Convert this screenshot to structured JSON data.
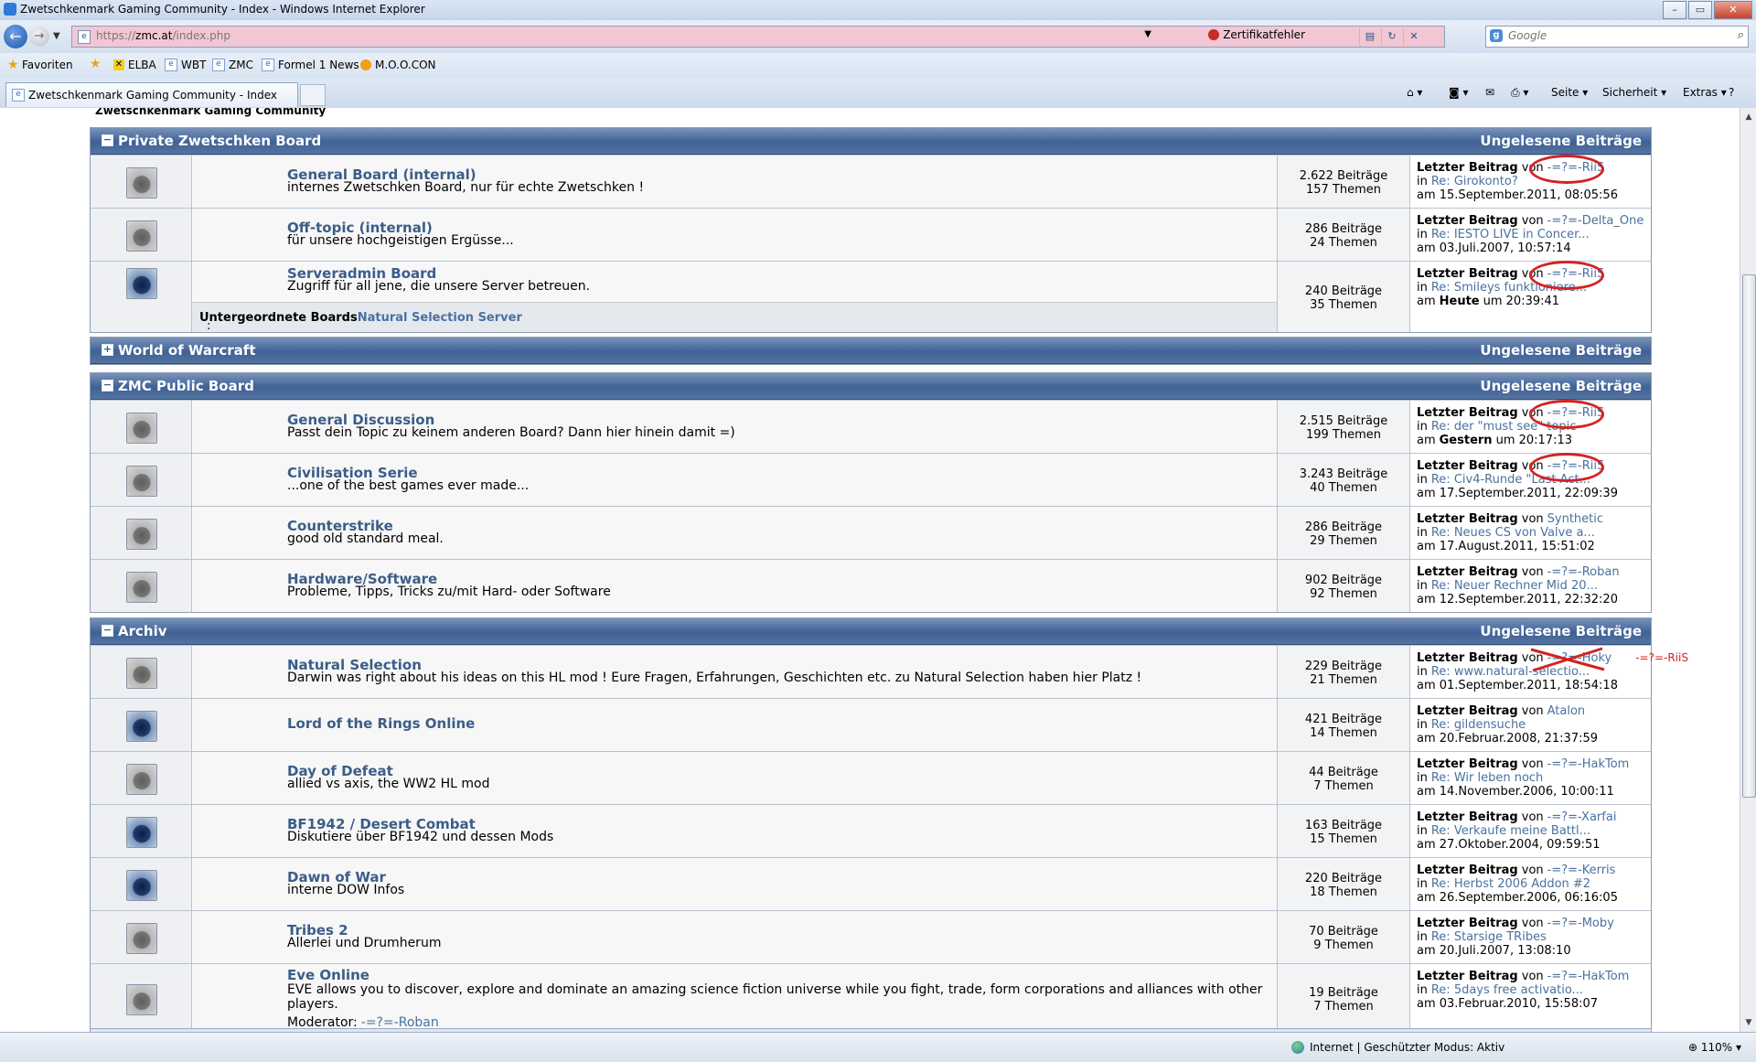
{
  "window": {
    "title": "Zwetschkenmark Gaming Community - Index - Windows Internet Explorer",
    "minimize": "–",
    "maximize": "▭",
    "close": "✕"
  },
  "nav": {
    "url_prefix": "https://",
    "url_host": "zmc.at",
    "url_path": "/index.php",
    "cert_error": "Zertifikatfehler",
    "search_placeholder": "Google"
  },
  "favorites": {
    "label": "Favoriten",
    "items": [
      "ELBA",
      "WBT",
      "ZMC",
      "Formel 1 News",
      "M.O.O.CON"
    ]
  },
  "tab": {
    "label": "Zwetschkenmark Gaming Community - Index"
  },
  "commands": {
    "page": "Seite",
    "security": "Sicherheit",
    "extras": "Extras"
  },
  "page": {
    "breadcrumb": "Zwetschkenmark Gaming Community"
  },
  "labels": {
    "unread": "Ungelesene Beiträge",
    "last_post": "Letzter Beitrag",
    "by": "von",
    "in": "in",
    "sub_boards": "Untergeordnete Boards",
    "moderator": "Moderator:"
  },
  "categories": [
    {
      "name": "Private Zwetschken Board",
      "toggle": "−",
      "boards": [
        {
          "title": "General Board (internal)",
          "desc": "internes Zwetschken Board, nur für echte Zwetschken !",
          "posts": "2.622 Beiträge",
          "topics": "157 Themen",
          "user": "-=?=-RiiS",
          "topic": "Re: Girokonto?",
          "date": "am 15.September.2011, 08:05:56",
          "icon_new": false
        },
        {
          "title": "Off-topic (internal)",
          "desc": "für unsere hochgeistigen Ergüsse...",
          "posts": "286 Beiträge",
          "topics": "24 Themen",
          "user": "-=?=-Delta_One",
          "topic": "Re: IESTO LIVE in Concer...",
          "date": "am 03.Juli.2007, 10:57:14",
          "icon_new": false
        },
        {
          "title": "Serveradmin Board",
          "desc": "Zugriff für all jene, die unsere Server betreuen.",
          "posts": "240 Beiträge",
          "topics": "35 Themen",
          "user": "-=?=-RiiS",
          "topic": "Re: Smileys funktioniere...",
          "date_pre": "am",
          "date_bold": "Heute",
          "date_post": "um 20:39:41",
          "sub_boards": "Natural Selection Server",
          "icon_new": true
        }
      ]
    },
    {
      "name": "World of Warcraft",
      "toggle": "+",
      "boards": []
    },
    {
      "name": "ZMC Public Board",
      "toggle": "−",
      "boards": [
        {
          "title": "General Discussion",
          "desc": "Passt dein Topic zu keinem anderen Board? Dann hier hinein damit =)",
          "posts": "2.515 Beiträge",
          "topics": "199 Themen",
          "user": "-=?=-RiiS",
          "topic": "Re: der \"must see\" topic",
          "date_pre": "am",
          "date_bold": "Gestern",
          "date_post": "um 20:17:13",
          "icon_new": false
        },
        {
          "title": "Civilisation Serie",
          "desc": "...one of the best games ever made...",
          "posts": "3.243 Beiträge",
          "topics": "40 Themen",
          "user": "-=?=-RiiS",
          "topic": "Re: Civ4-Runde \"Last Act...",
          "date": "am 17.September.2011, 22:09:39",
          "icon_new": false
        },
        {
          "title": "Counterstrike",
          "desc": "good old standard meal.",
          "posts": "286 Beiträge",
          "topics": "29 Themen",
          "user": "Synthetic",
          "topic": "Re: Neues CS von Valve a...",
          "date": "am 17.August.2011, 15:51:02",
          "icon_new": false
        },
        {
          "title": "Hardware/Software",
          "desc": "Probleme, Tipps, Tricks zu/mit Hard- oder Software",
          "posts": "902 Beiträge",
          "topics": "92 Themen",
          "user": "-=?=-Roban",
          "topic": "Re: Neuer Rechner Mid 20...",
          "date": "am 12.September.2011, 22:32:20",
          "icon_new": false
        }
      ]
    },
    {
      "name": "Archiv",
      "toggle": "−",
      "boards": [
        {
          "title": "Natural Selection",
          "desc": "Darwin was right about his ideas on this HL mod ! Eure Fragen, Erfahrungen, Geschichten etc. zu Natural Selection haben hier Platz !",
          "posts": "229 Beiträge",
          "topics": "21 Themen",
          "user": "-=?=-Hoky",
          "user_correction": "-=?=-RiiS",
          "topic": "Re: www.natural-selectio...",
          "date": "am 01.September.2011, 18:54:18",
          "icon_new": false
        },
        {
          "title": "Lord of the Rings Online",
          "desc": "",
          "posts": "421 Beiträge",
          "topics": "14 Themen",
          "user": "Atalon",
          "topic": "Re: gildensuche",
          "date": "am 20.Februar.2008, 21:37:59",
          "icon_new": true
        },
        {
          "title": "Day of Defeat",
          "desc": "allied vs axis, the WW2 HL mod",
          "posts": "44 Beiträge",
          "topics": "7 Themen",
          "user": "-=?=-HakTom",
          "topic": "Re: Wir leben noch",
          "date": "am 14.November.2006, 10:00:11",
          "icon_new": false
        },
        {
          "title": "BF1942 / Desert Combat",
          "desc": "Diskutiere über BF1942 und dessen Mods",
          "posts": "163 Beiträge",
          "topics": "15 Themen",
          "user": "-=?=-Xarfai",
          "topic": "Re: Verkaufe meine Battl...",
          "date": "am 27.Oktober.2004, 09:59:51",
          "icon_new": true
        },
        {
          "title": "Dawn of War",
          "desc": "interne DOW Infos",
          "posts": "220 Beiträge",
          "topics": "18 Themen",
          "user": "-=?=-Kerris",
          "topic": "Re: Herbst 2006 Addon #2",
          "date": "am 26.September.2006, 06:16:05",
          "icon_new": true
        },
        {
          "title": "Tribes 2",
          "desc": "Allerlei und Drumherum",
          "posts": "70 Beiträge",
          "topics": "9 Themen",
          "user": "-=?=-Moby",
          "topic": "Re: Starsige TRibes",
          "date": "am 20.Juli.2007, 13:08:10",
          "icon_new": false
        },
        {
          "title": "Eve Online",
          "desc": "EVE allows you to discover, explore and dominate an amazing science fiction universe while you fight, trade, form corporations and alliances with other players.",
          "posts": "19 Beiträge",
          "topics": "7 Themen",
          "user": "-=?=-HakTom",
          "topic": "Re: 5days free activatio...",
          "date": "am 03.Februar.2010, 15:58:07",
          "moderator": "-=?=-Roban",
          "icon_new": false
        }
      ]
    }
  ],
  "status": {
    "text": "Internet | Geschützter Modus: Aktiv",
    "zoom": "110%"
  }
}
